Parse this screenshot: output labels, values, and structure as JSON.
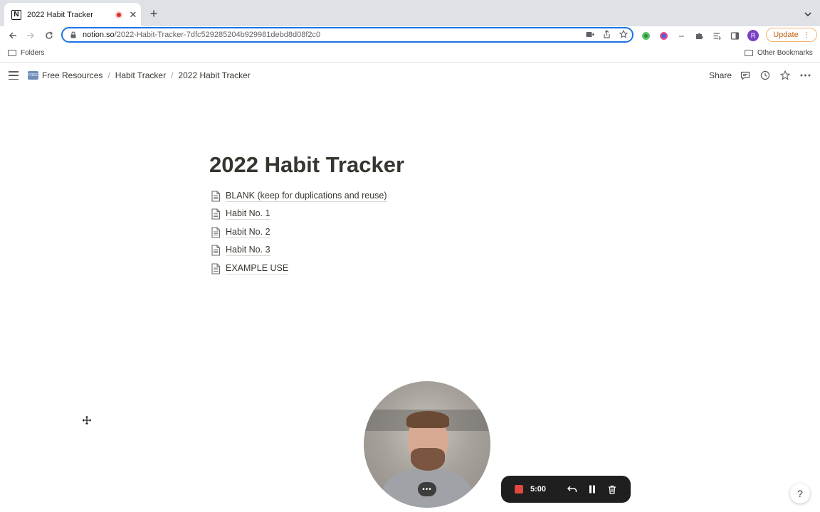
{
  "browser": {
    "tab": {
      "favicon": "N",
      "title": "2022 Habit Tracker"
    },
    "url": {
      "host": "notion.so",
      "path": "/2022-Habit-Tracker-7dfc529285204b929981debd8d08f2c0"
    },
    "profile_initial": "R",
    "update_label": "Update",
    "bookmarks": {
      "folders": "Folders",
      "other": "Other Bookmarks"
    }
  },
  "notion": {
    "breadcrumb": [
      {
        "label": "Free Resources",
        "icon_text": "FREE"
      },
      {
        "label": "Habit Tracker"
      },
      {
        "label": "2022 Habit Tracker"
      }
    ],
    "separator": "/",
    "share_label": "Share"
  },
  "page": {
    "title": "2022 Habit Tracker",
    "subpages": [
      "BLANK (keep for duplications and reuse)",
      "Habit No. 1",
      "Habit No. 2",
      "Habit No. 3",
      "EXAMPLE USE"
    ]
  },
  "recorder": {
    "timer": "5:00",
    "cam_menu": "•••",
    "stop_color": "#e2483d"
  },
  "help_label": "?"
}
